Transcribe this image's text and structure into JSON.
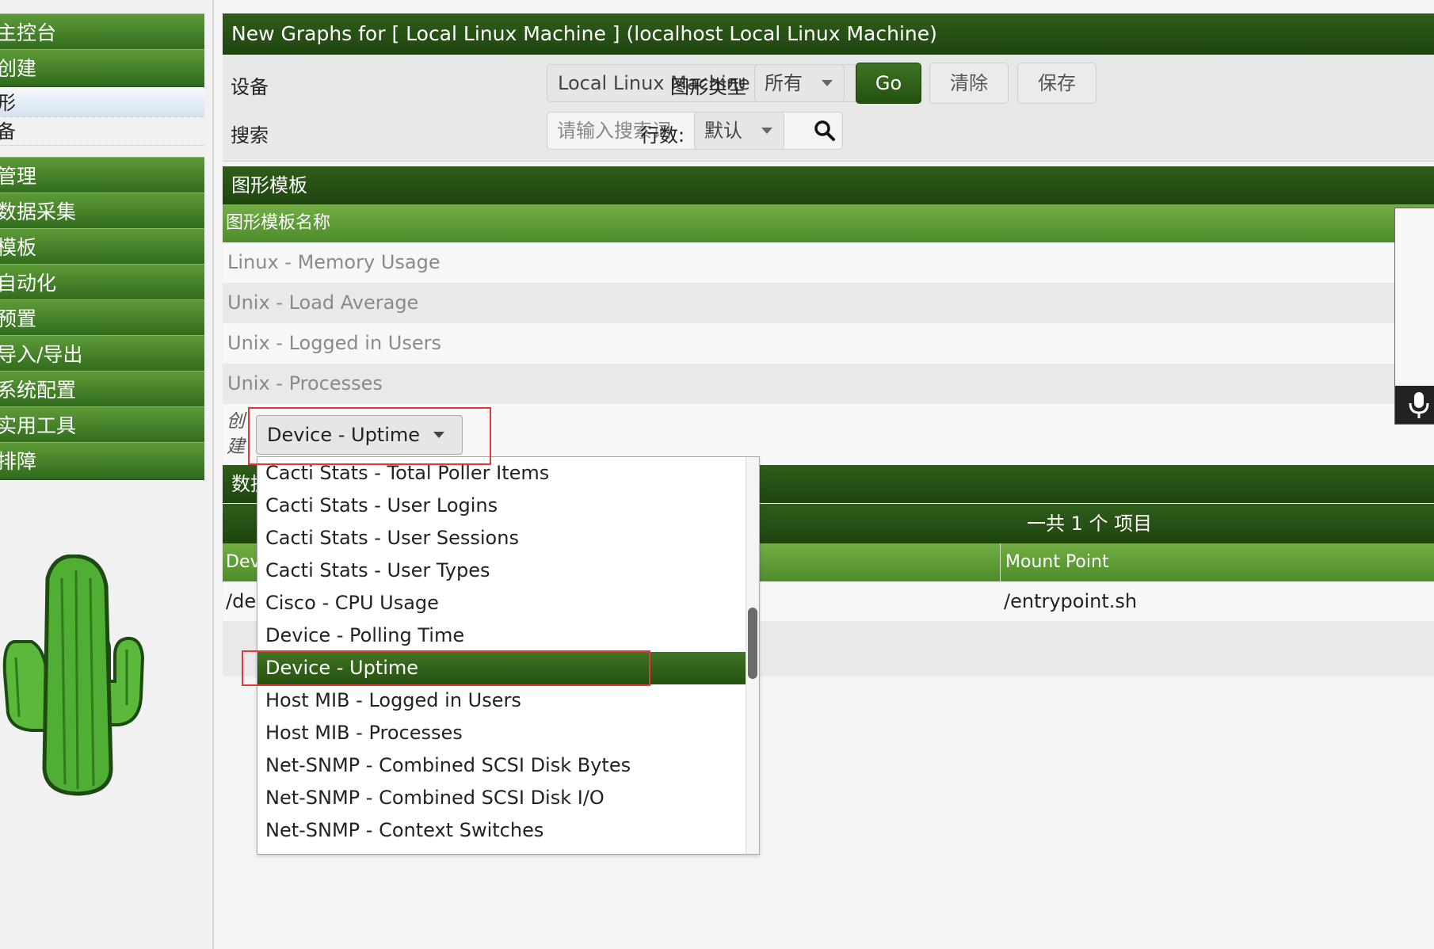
{
  "sidebar": {
    "items": [
      {
        "label": "主控台",
        "type": "nav"
      },
      {
        "label": "创建",
        "type": "nav"
      },
      {
        "label": "形",
        "type": "sub",
        "active": true
      },
      {
        "label": "备",
        "type": "sub"
      },
      {
        "label": "管理",
        "type": "nav"
      },
      {
        "label": "数据采集",
        "type": "nav"
      },
      {
        "label": "模板",
        "type": "nav"
      },
      {
        "label": "自动化",
        "type": "nav"
      },
      {
        "label": "预置",
        "type": "nav"
      },
      {
        "label": "导入/导出",
        "type": "nav"
      },
      {
        "label": "系统配置",
        "type": "nav"
      },
      {
        "label": "实用工具",
        "type": "nav"
      },
      {
        "label": "排障",
        "type": "nav"
      }
    ]
  },
  "header": {
    "title": "New Graphs for [ Local Linux Machine ] (localhost Local Linux Machine)"
  },
  "filter": {
    "device_label": "设备",
    "device_value": "Local Linux Machine",
    "graph_type_label": "图形类型",
    "graph_type_value": "所有",
    "go_label": "Go",
    "clear_label": "清除",
    "save_label": "保存",
    "search_label": "搜索",
    "search_placeholder": "请输入搜索词",
    "rows_label": "行数:",
    "rows_value": "默认"
  },
  "graph_templates": {
    "title": "图形模板",
    "column_header": "图形模板名称",
    "rows": [
      "Linux - Memory Usage",
      "Unix - Load Average",
      "Unix - Logged in Users",
      "Unix - Processes"
    ],
    "create_label": "创建",
    "create_selected": "Device - Uptime"
  },
  "data_query": {
    "title_fragment": "数据",
    "count_text": "一共 1 个 项目",
    "columns": [
      "Dev",
      "Mount Point"
    ],
    "row": {
      "device": "/de",
      "mount_point": "/entrypoint.sh"
    }
  },
  "dropdown": {
    "options": [
      "Cacti Stats - Total Poller Items",
      "Cacti Stats - User Logins",
      "Cacti Stats - User Sessions",
      "Cacti Stats - User Types",
      "Cisco - CPU Usage",
      "Device - Polling Time",
      "Device - Uptime",
      "Host MIB - Logged in Users",
      "Host MIB - Processes",
      "Net-SNMP - Combined SCSI Disk Bytes",
      "Net-SNMP - Combined SCSI Disk I/O",
      "Net-SNMP - Context Switches"
    ],
    "selected_index": 6
  },
  "colors": {
    "header_dark": "#2f5e19",
    "header_light": "#72ae44",
    "highlight_red": "#e53935"
  },
  "icons": {
    "search": "search-icon",
    "caret": "chevron-down-icon",
    "logo": "cactus-logo"
  }
}
